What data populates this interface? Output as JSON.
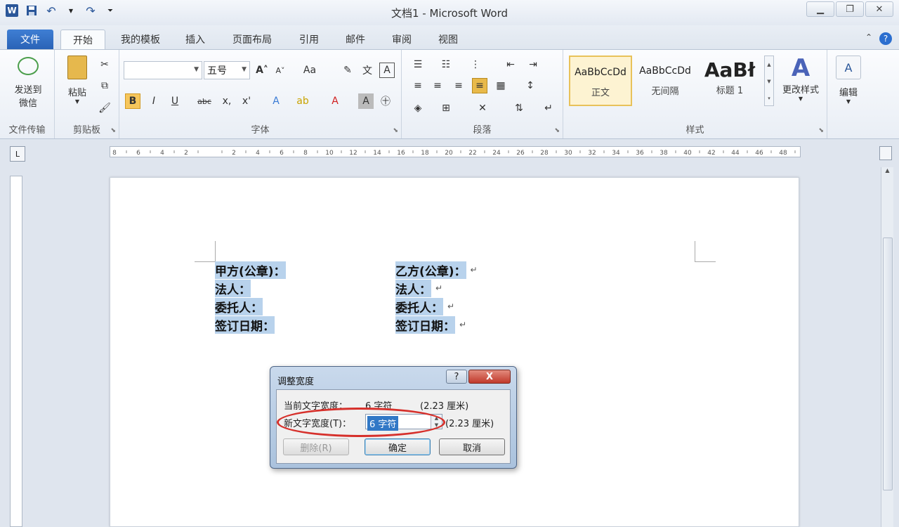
{
  "window": {
    "title": "文档1 - Microsoft Word",
    "app_icon": "W"
  },
  "tabs": [
    {
      "label": "文件"
    },
    {
      "label": "开始"
    },
    {
      "label": "我的模板"
    },
    {
      "label": "插入"
    },
    {
      "label": "页面布局"
    },
    {
      "label": "引用"
    },
    {
      "label": "邮件"
    },
    {
      "label": "审阅"
    },
    {
      "label": "视图"
    }
  ],
  "ribbon": {
    "wechat": {
      "label_line1": "发送到",
      "label_line2": "微信",
      "group": "文件传输"
    },
    "clipboard": {
      "paste_label": "粘贴",
      "group": "剪贴板"
    },
    "font": {
      "font_name": "",
      "font_size": "五号",
      "group": "字体",
      "bold": "B",
      "italic": "I",
      "underline": "U",
      "strike": "abc",
      "subscript": "x,",
      "superscript": "x'"
    },
    "paragraph": {
      "group": "段落"
    },
    "styles": {
      "items": [
        {
          "sample": "AaBbCcDd",
          "name": "正文"
        },
        {
          "sample": "AaBbCcDd",
          "name": "无间隔"
        },
        {
          "sample": "AaBł",
          "name": "标题 1"
        }
      ],
      "change_label": "更改样式",
      "group": "样式"
    },
    "editing": {
      "label": "编辑"
    }
  },
  "ruler": {
    "ticks": [
      "8",
      "6",
      "4",
      "2",
      "",
      "2",
      "4",
      "6",
      "8",
      "10",
      "12",
      "14",
      "16",
      "18",
      "20",
      "22",
      "24",
      "26",
      "28",
      "30",
      "32",
      "34",
      "36",
      "38",
      "40",
      "42",
      "44",
      "46",
      "48"
    ]
  },
  "document": {
    "left": [
      "甲方(公章)：",
      "法人：",
      "委托人：",
      "签订日期："
    ],
    "right": [
      "乙方(公章)：",
      "法人：",
      "委托人：",
      "签订日期："
    ]
  },
  "dialog": {
    "title": "调整宽度",
    "help": "?",
    "close": "X",
    "current_label": "当前文字宽度：",
    "current_value": "6 字符",
    "current_cm": "(2.23 厘米)",
    "new_label": "新文字宽度(T)：",
    "new_value": "6 字符",
    "new_cm": "(2.23 厘米)",
    "delete_btn": "删除(R)",
    "ok_btn": "确定",
    "cancel_btn": "取消"
  }
}
